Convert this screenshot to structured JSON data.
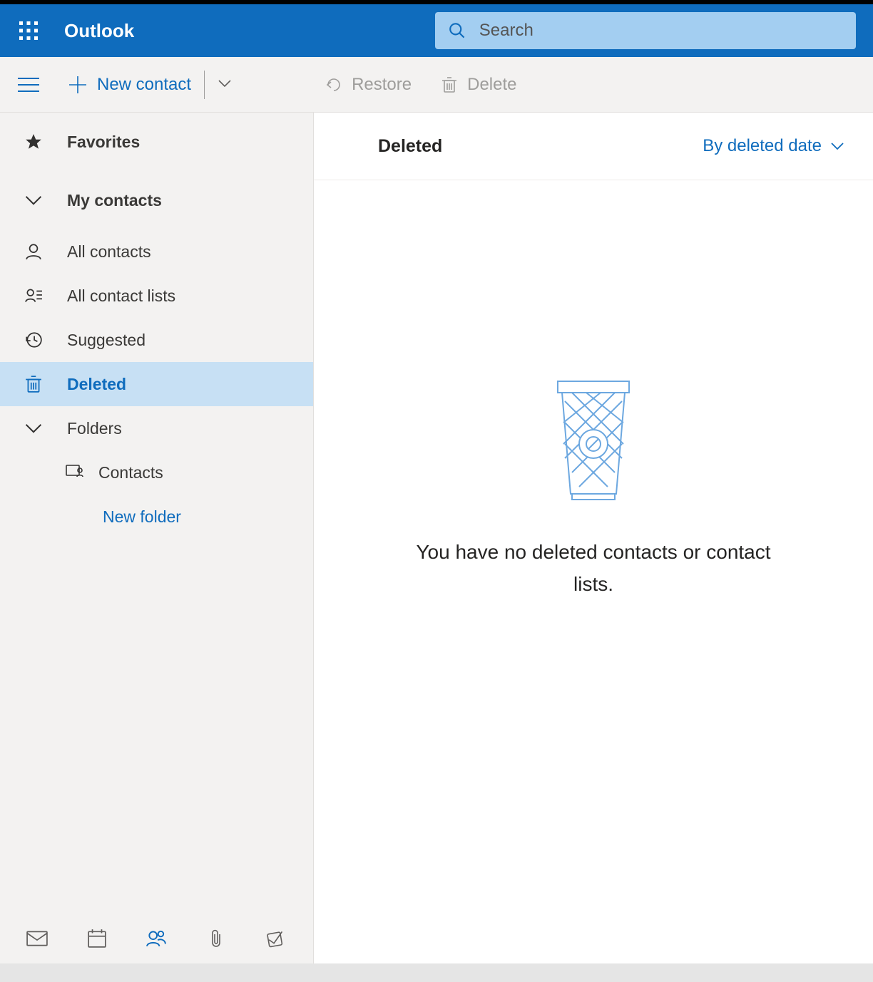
{
  "header": {
    "app_title": "Outlook",
    "search_placeholder": "Search"
  },
  "toolbar": {
    "new_contact_label": "New contact",
    "restore_label": "Restore",
    "delete_label": "Delete"
  },
  "sidebar": {
    "favorites_label": "Favorites",
    "my_contacts_label": "My contacts",
    "items": [
      {
        "label": "All contacts"
      },
      {
        "label": "All contact lists"
      },
      {
        "label": "Suggested"
      },
      {
        "label": "Deleted"
      }
    ],
    "folders_label": "Folders",
    "folder_items": [
      {
        "label": "Contacts"
      }
    ],
    "new_folder_label": "New folder"
  },
  "main": {
    "title": "Deleted",
    "sort_label": "By deleted date",
    "empty_message": "You have no deleted contacts or contact lists."
  }
}
